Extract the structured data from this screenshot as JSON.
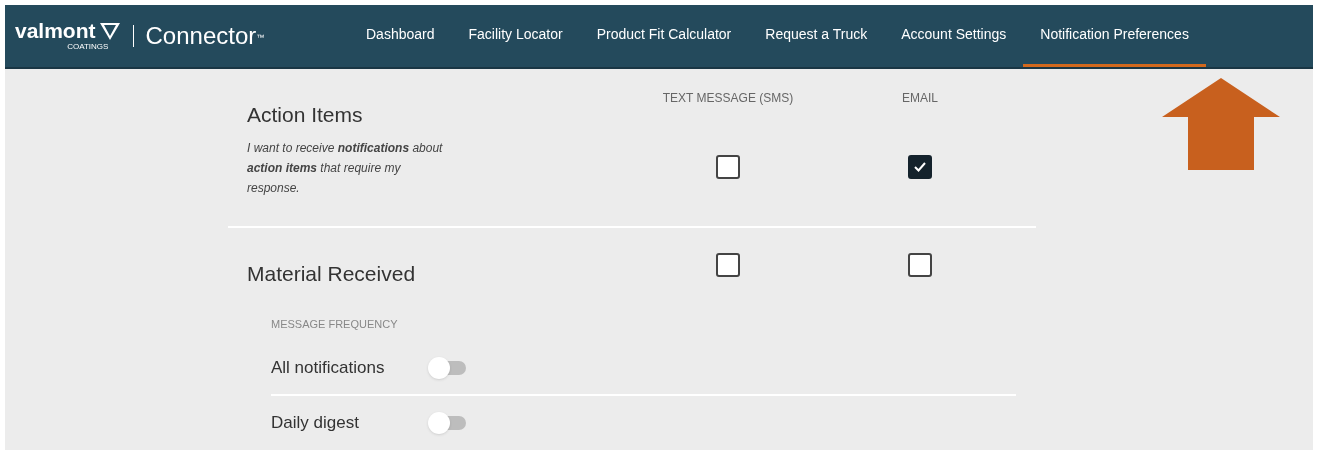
{
  "header": {
    "logo": {
      "brand": "valmont",
      "sub": "COATINGS",
      "product": "Connector",
      "mark": "™"
    },
    "nav": [
      {
        "label": "Dashboard",
        "selected": false
      },
      {
        "label": "Facility Locator",
        "selected": false
      },
      {
        "label": "Product Fit Calculator",
        "selected": false
      },
      {
        "label": "Request a Truck",
        "selected": false
      },
      {
        "label": "Account Settings",
        "selected": false
      },
      {
        "label": "Notification Preferences",
        "selected": true
      }
    ]
  },
  "columns": [
    "TEXT MESSAGE (SMS)",
    "EMAIL"
  ],
  "sections": [
    {
      "title": "Action Items",
      "description": "I want to receive **notifications** about **action items** that require my response.",
      "sms": {
        "checked": false
      },
      "email": {
        "checked": true
      }
    },
    {
      "title": "Material Received",
      "sms": {
        "checked": false
      },
      "email": {
        "checked": false
      },
      "frequency_label": "MESSAGE FREQUENCY",
      "options": [
        {
          "label": "All notifications",
          "on": false
        },
        {
          "label": "Daily digest",
          "on": false
        }
      ]
    }
  ]
}
